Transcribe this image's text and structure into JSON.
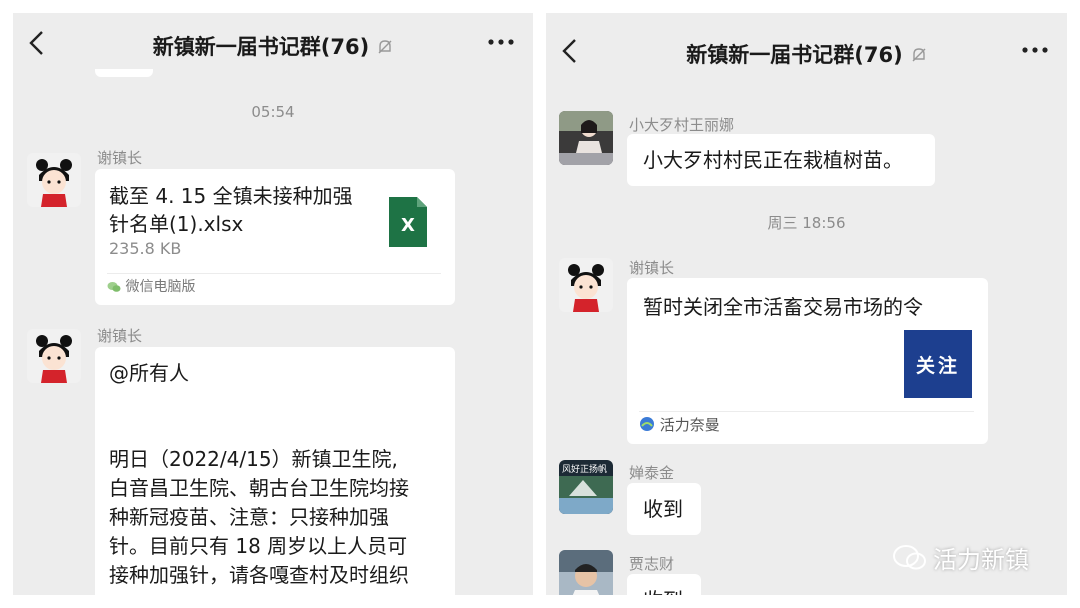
{
  "left": {
    "header": {
      "title": "新镇新一届书记群(76)"
    },
    "time": "05:54",
    "msg1": {
      "sender": "谢镇长",
      "file_name_line1": "截至 4. 15 全镇未接种加强",
      "file_name_line2": "针名单(1).xlsx",
      "file_size": "235.8 KB",
      "file_icon_letter": "X",
      "source": "微信电脑版"
    },
    "msg2": {
      "sender": "谢镇长",
      "mention": "@所有人",
      "line1": "明日（2022/4/15）新镇卫生院,",
      "line2": "白音昌卫生院、朝古台卫生院均接",
      "line3": "种新冠疫苗、注意：只接种加强",
      "line4": "针。目前只有 18 周岁以上人员可",
      "line5": "接种加强针，请各嘎查村及时组织"
    }
  },
  "right": {
    "header": {
      "title": "新镇新一届书记群(76)"
    },
    "msg1": {
      "sender": "小大歹村王丽娜",
      "text": "小大歹村村民正在栽植树苗。"
    },
    "time": "周三 18:56",
    "msg2": {
      "sender": "谢镇长",
      "card_title": "暂时关闭全市活畜交易市场的令",
      "thumb_text": "关注",
      "source": "活力奈曼"
    },
    "msg3": {
      "sender": "婵泰金",
      "text": "收到",
      "avatar_text": "风好正扬帆"
    },
    "msg4": {
      "sender": "贾志财",
      "text": "收到"
    }
  },
  "watermark": "活力新镇",
  "colors": {
    "background": "#ededed",
    "bubble": "#ffffff",
    "excel_green": "#1e7345",
    "thumb_blue": "#1d3f8f",
    "meta_gray": "#8c8c8c"
  }
}
